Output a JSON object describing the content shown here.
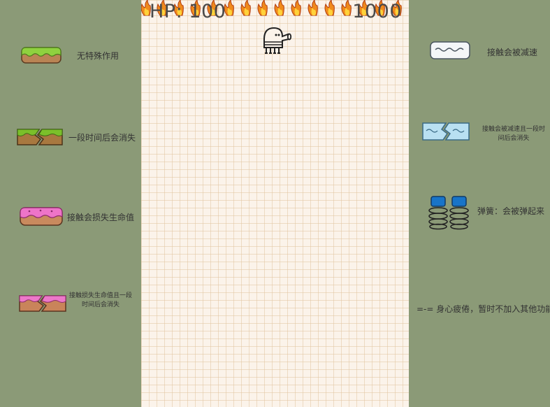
{
  "hud": {
    "hp": "HP: 100",
    "score": "1000"
  },
  "legend_left": [
    {
      "icon": "green-grass-platform-icon",
      "text": "无特殊作用"
    },
    {
      "icon": "broken-green-platform-icon",
      "text": "一段时间后会消失"
    },
    {
      "icon": "pink-platform-icon",
      "text": "接触会损失生命值"
    },
    {
      "icon": "broken-pink-platform-icon",
      "text": "接触损失生命值且一段时间后会消失"
    }
  ],
  "legend_right": [
    {
      "icon": "white-ice-platform-icon",
      "text": "接触会被减速"
    },
    {
      "icon": "broken-blue-ice-platform-icon",
      "text": "接触会被减速且一段时间后会消失"
    },
    {
      "icon": "spring-icon",
      "text": "弹簧：会被弹起来"
    },
    {
      "icon": "",
      "text": "=-= 身心疲倦，暂时不加入其他功能"
    }
  ],
  "colors": {
    "side_bg": "#8b9a77",
    "game_bg": "#fbf3ea",
    "grid": "#e2c4a0"
  }
}
